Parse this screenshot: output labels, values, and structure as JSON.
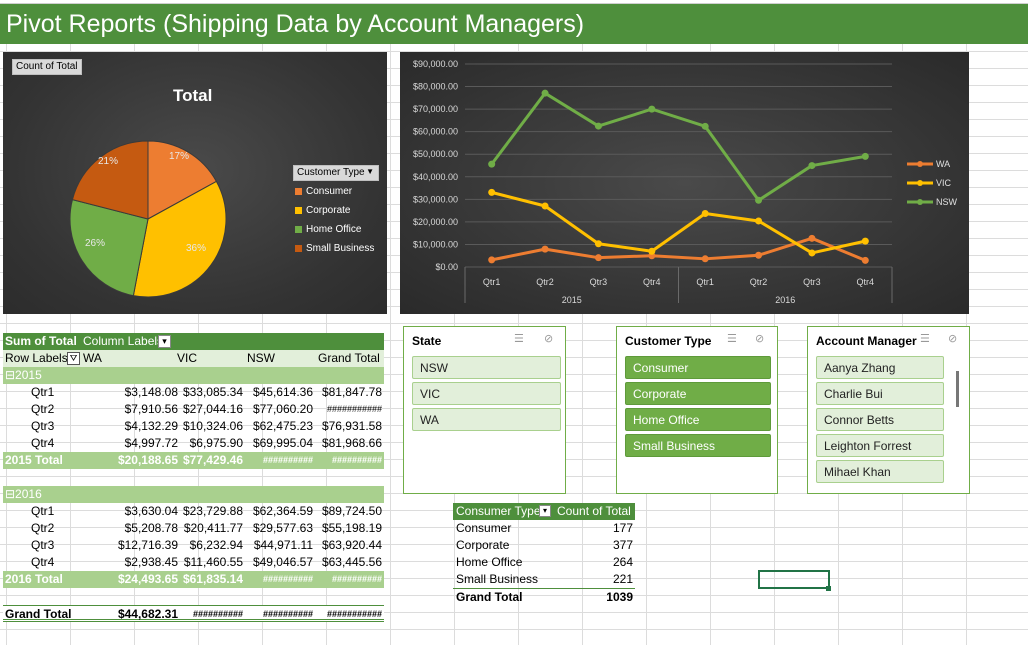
{
  "title": "Pivot Reports  (Shipping Data by Account Managers)",
  "pie_chart": {
    "field_button": "Count of Total",
    "title": "Total",
    "legend_button": "Customer Type",
    "legend": [
      {
        "label": "Consumer",
        "color": "#ed7d31"
      },
      {
        "label": "Corporate",
        "color": "#ffc000"
      },
      {
        "label": "Home Office",
        "color": "#70ad47"
      },
      {
        "label": "Small Business",
        "color": "#c55a11"
      }
    ],
    "slice_labels": [
      "17%",
      "36%",
      "26%",
      "21%"
    ]
  },
  "chart_data": {
    "type": "line",
    "categories": [
      "Qtr1",
      "Qtr2",
      "Qtr3",
      "Qtr4",
      "Qtr1",
      "Qtr2",
      "Qtr3",
      "Qtr4"
    ],
    "groups": [
      "2015",
      "2016"
    ],
    "y_ticks": [
      "$90,000.00",
      "$80,000.00",
      "$70,000.00",
      "$60,000.00",
      "$50,000.00",
      "$40,000.00",
      "$30,000.00",
      "$20,000.00",
      "$10,000.00",
      "$0.00"
    ],
    "ylim": [
      0,
      90000
    ],
    "legend_position": "right",
    "series": [
      {
        "name": "WA",
        "color": "#ed7d31",
        "values": [
          3148.08,
          7910.56,
          4132.29,
          4997.72,
          3630.04,
          5208.78,
          12716.39,
          2938.45
        ]
      },
      {
        "name": "VIC",
        "color": "#ffc000",
        "values": [
          33085.34,
          27044.16,
          10324.06,
          6975.9,
          23729.88,
          20411.77,
          6232.94,
          11460.55
        ]
      },
      {
        "name": "NSW",
        "color": "#70ad47",
        "values": [
          45614.36,
          77060.2,
          62475.23,
          69995.04,
          62364.59,
          29577.63,
          44971.11,
          49046.57
        ]
      }
    ]
  },
  "pivot": {
    "corner": "Sum of Total",
    "column_labels": "Column Labels",
    "row_labels": "Row Labels",
    "columns": [
      "WA",
      "VIC",
      "NSW",
      "Grand Total"
    ],
    "year_2015": "⊟2015",
    "rows_2015": [
      [
        "Qtr1",
        "$3,148.08",
        "$33,085.34",
        "$45,614.36",
        "$81,847.78"
      ],
      [
        "Qtr2",
        "$7,910.56",
        "$27,044.16",
        "$77,060.20",
        "###########"
      ],
      [
        "Qtr3",
        "$4,132.29",
        "$10,324.06",
        "$62,475.23",
        "$76,931.58"
      ],
      [
        "Qtr4",
        "$4,997.72",
        "$6,975.90",
        "$69,995.04",
        "$81,968.66"
      ]
    ],
    "total_2015": [
      "2015 Total",
      "$20,188.65",
      "$77,429.46",
      "##########",
      "##########"
    ],
    "year_2016": "⊟2016",
    "rows_2016": [
      [
        "Qtr1",
        "$3,630.04",
        "$23,729.88",
        "$62,364.59",
        "$89,724.50"
      ],
      [
        "Qtr2",
        "$5,208.78",
        "$20,411.77",
        "$29,577.63",
        "$55,198.19"
      ],
      [
        "Qtr3",
        "$12,716.39",
        "$6,232.94",
        "$44,971.11",
        "$63,920.44"
      ],
      [
        "Qtr4",
        "$2,938.45",
        "$11,460.55",
        "$49,046.57",
        "$63,445.56"
      ]
    ],
    "total_2016": [
      "2016 Total",
      "$24,493.65",
      "$61,835.14",
      "##########",
      "##########"
    ],
    "grand_total": [
      "Grand Total",
      "$44,682.31",
      "##########",
      "##########",
      "###########"
    ]
  },
  "slicers": {
    "state": {
      "title": "State",
      "items": [
        "NSW",
        "VIC",
        "WA"
      ]
    },
    "customer_type": {
      "title": "Customer Type",
      "items": [
        "Consumer",
        "Corporate",
        "Home Office",
        "Small Business"
      ]
    },
    "account_manager": {
      "title": "Account Manager",
      "items": [
        "Aanya Zhang",
        "Charlie Bui",
        "Connor Betts",
        "Leighton Forrest",
        "Mihael Khan"
      ]
    }
  },
  "small_pivot": {
    "header": [
      "Consumer Type",
      "Count of Total"
    ],
    "rows": [
      [
        "Consumer",
        "177"
      ],
      [
        "Corporate",
        "377"
      ],
      [
        "Home Office",
        "264"
      ],
      [
        "Small Business",
        "221"
      ]
    ],
    "total": [
      "Grand Total",
      "1039"
    ]
  }
}
